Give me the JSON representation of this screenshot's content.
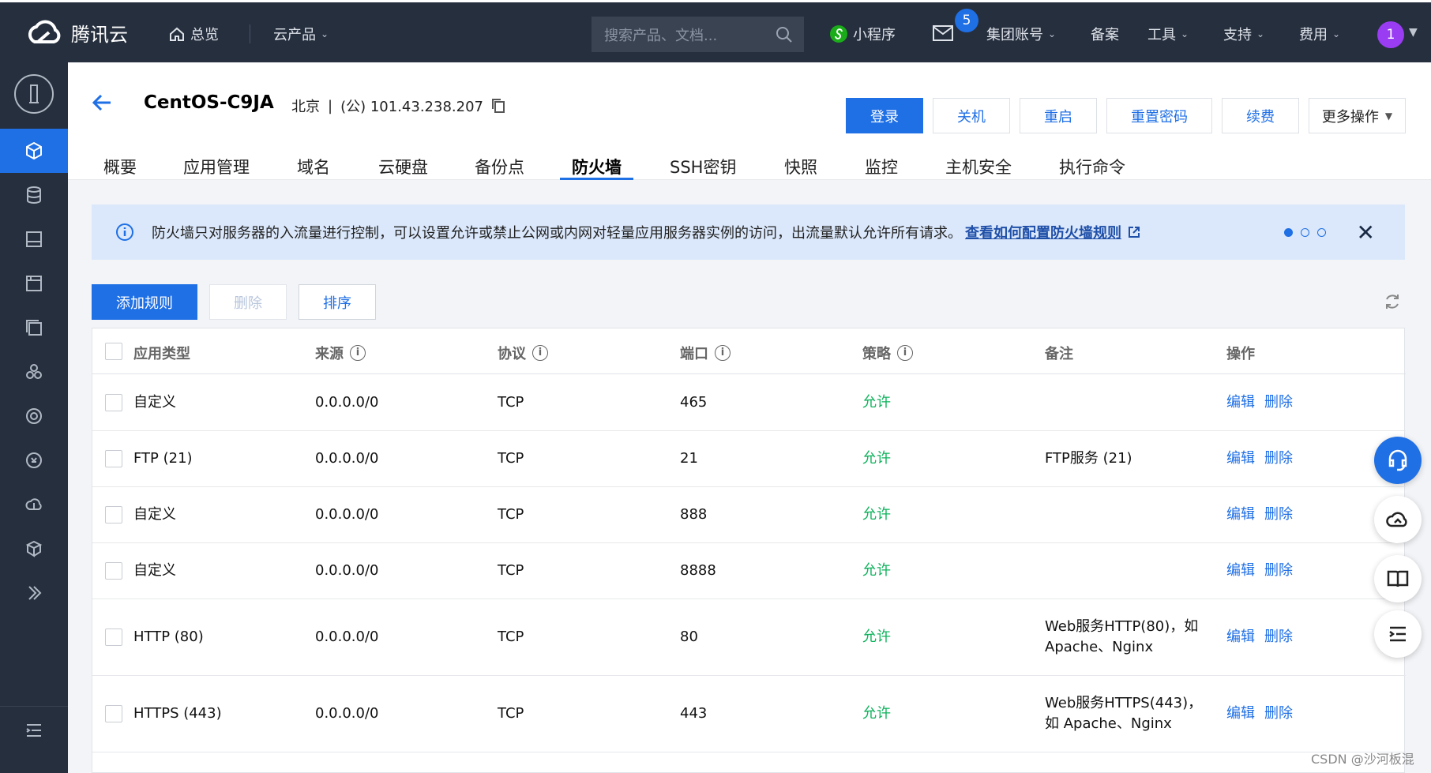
{
  "topbar": {
    "brand": "腾讯云",
    "overview": "总览",
    "products": "云产品",
    "search_placeholder": "搜索产品、文档...",
    "mini_program": "小程序",
    "mail_badge": "5",
    "group_account": "集团账号",
    "filing": "备案",
    "tools": "工具",
    "support": "支持",
    "billing": "费用",
    "avatar": "1"
  },
  "instance": {
    "name": "CentOS-C9JA",
    "region": "北京",
    "sep": "|",
    "ip": "(公) 101.43.238.207"
  },
  "actions": {
    "login": "登录",
    "shutdown": "关机",
    "restart": "重启",
    "reset_password": "重置密码",
    "renew": "续费",
    "more": "更多操作"
  },
  "tabs": [
    "概要",
    "应用管理",
    "域名",
    "云硬盘",
    "备份点",
    "防火墙",
    "SSH密钥",
    "快照",
    "监控",
    "主机安全",
    "执行命令"
  ],
  "notice": {
    "text": "防火墙只对服务器的入流量进行控制，可以设置允许或禁止公网或内网对轻量应用服务器实例的访问，出流量默认允许所有请求。",
    "link": "查看如何配置防火墙规则"
  },
  "toolbar": {
    "add_rule": "添加规则",
    "delete": "删除",
    "sort": "排序"
  },
  "table": {
    "headers": {
      "app_type": "应用类型",
      "source": "来源",
      "protocol": "协议",
      "port": "端口",
      "policy": "策略",
      "remark": "备注",
      "ops": "操作"
    },
    "rows": [
      {
        "app": "自定义",
        "source": "0.0.0.0/0",
        "protocol": "TCP",
        "port": "465",
        "policy": "允许",
        "remark1": "",
        "remark2": "",
        "edit": "编辑",
        "del": "删除"
      },
      {
        "app": "FTP (21)",
        "source": "0.0.0.0/0",
        "protocol": "TCP",
        "port": "21",
        "policy": "允许",
        "remark1": "FTP服务 (21)",
        "remark2": "",
        "edit": "编辑",
        "del": "删除"
      },
      {
        "app": "自定义",
        "source": "0.0.0.0/0",
        "protocol": "TCP",
        "port": "888",
        "policy": "允许",
        "remark1": "",
        "remark2": "",
        "edit": "编辑",
        "del": "删除"
      },
      {
        "app": "自定义",
        "source": "0.0.0.0/0",
        "protocol": "TCP",
        "port": "8888",
        "policy": "允许",
        "remark1": "",
        "remark2": "",
        "edit": "编辑",
        "del": "删除"
      },
      {
        "app": "HTTP (80)",
        "source": "0.0.0.0/0",
        "protocol": "TCP",
        "port": "80",
        "policy": "允许",
        "remark1": "Web服务HTTP(80)，如",
        "remark2": "Apache、Nginx",
        "edit": "编辑",
        "del": "删除"
      },
      {
        "app": "HTTPS (443)",
        "source": "0.0.0.0/0",
        "protocol": "TCP",
        "port": "443",
        "policy": "允许",
        "remark1": "Web服务HTTPS(443)，",
        "remark2": "如 Apache、Nginx",
        "edit": "编辑",
        "del": "删除"
      }
    ]
  },
  "watermark": "CSDN @沙河板混"
}
